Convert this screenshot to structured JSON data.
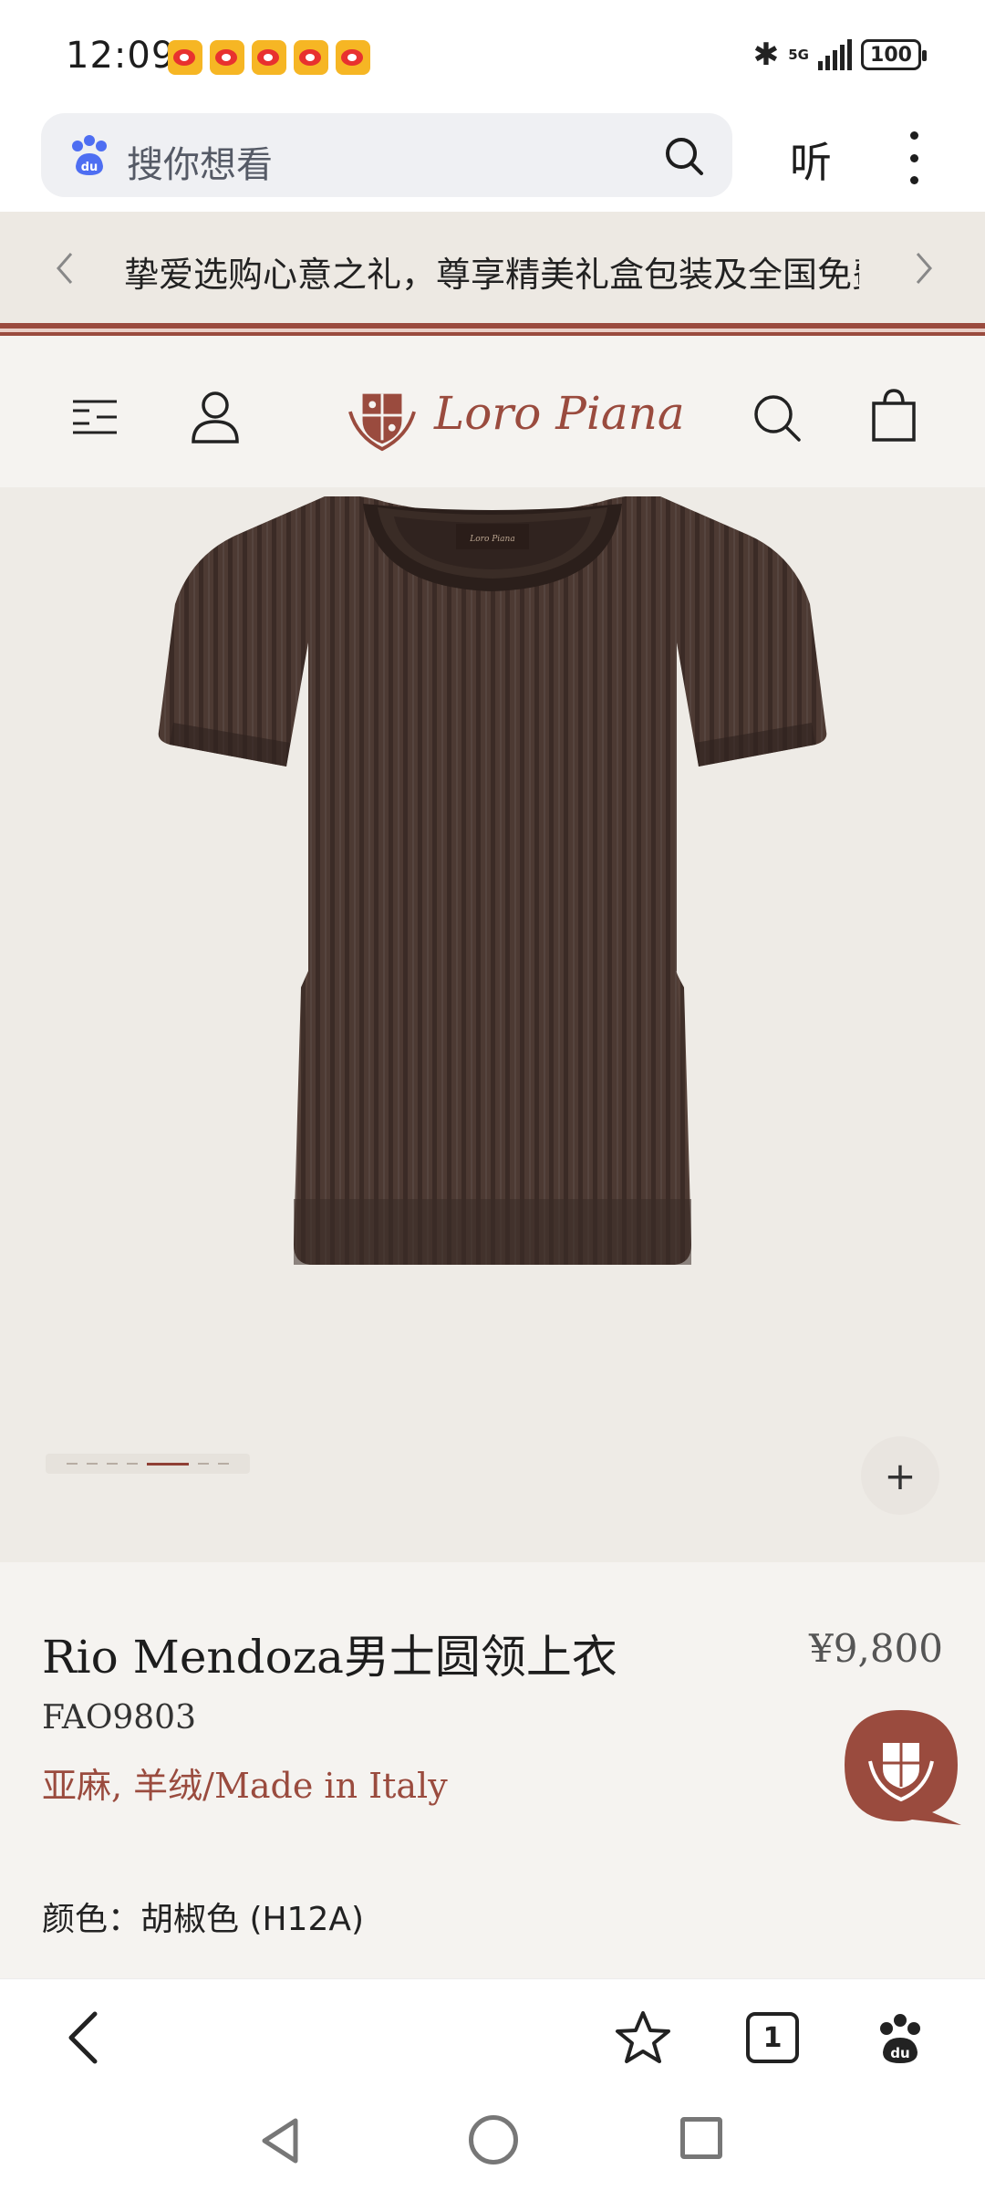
{
  "status_bar": {
    "time": "12:09",
    "network": "5G",
    "battery": "100"
  },
  "browser": {
    "search_placeholder": "搜你想看",
    "listen_label": "听"
  },
  "announcement": {
    "text": "挚爱选购心意之礼，尊享精美礼盒包装及全国免费配送服务"
  },
  "brand": {
    "name": "Loro Piana",
    "color": "#9a4b3e"
  },
  "product": {
    "image_carousel": {
      "total_images": 7,
      "current_index": 4
    },
    "title": "Rio Mendoza男士圆领上衣",
    "price": "¥9,800",
    "code": "FAO9803",
    "material": "亚麻, 羊绒/Made in Italy",
    "color_label": "颜色：胡椒色 (H12A)",
    "zoom_label": "+"
  },
  "bottom_nav": {
    "tabs_count": "1"
  },
  "icons": [
    "weibo-icon",
    "bluetooth-icon",
    "signal-icon",
    "battery-icon",
    "du-logo-icon",
    "search-icon",
    "more-icon",
    "chevron-left-icon",
    "chevron-right-icon",
    "menu-icon",
    "account-icon",
    "bag-icon",
    "chat-icon",
    "back-icon",
    "star-icon",
    "tabs-icon",
    "home-icon",
    "recents-icon"
  ]
}
